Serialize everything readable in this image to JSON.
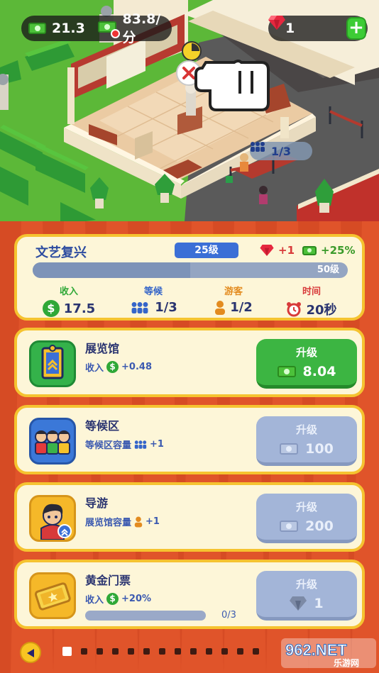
{
  "hud": {
    "money": "21.3",
    "income_rate": "83.8/分",
    "gems": "1"
  },
  "scene": {
    "visitor_count": "1/3"
  },
  "exhibit": {
    "name": "文艺复兴",
    "level": "25级",
    "reward_gem": "+1",
    "reward_pct": "+25%",
    "progress_label": "50级",
    "progress_fraction": 0.5,
    "stats": [
      {
        "label": "收入",
        "value": "17.5",
        "color": "#2fa837"
      },
      {
        "label": "等候",
        "value": "1/3",
        "color": "#3565c9"
      },
      {
        "label": "游客",
        "value": "1/2",
        "color": "#e38b1f"
      },
      {
        "label": "时间",
        "value": "20秒",
        "color": "#d83a3a"
      }
    ]
  },
  "upgrades": [
    {
      "title": "展览馆",
      "sub_prefix": "收入",
      "sub_value": "+0.48",
      "button_label": "升级",
      "cost": "8.04",
      "enabled": true,
      "icon": "gallery-icon"
    },
    {
      "title": "等候区",
      "sub_prefix": "等候区容量",
      "sub_value": "+1",
      "button_label": "升级",
      "cost": "100",
      "enabled": false,
      "icon": "waiting-people-icon"
    },
    {
      "title": "导游",
      "sub_prefix": "展览馆容量",
      "sub_value": "+1",
      "button_label": "升级",
      "cost": "200",
      "enabled": false,
      "icon": "guide-icon"
    },
    {
      "title": "黄金门票",
      "sub_prefix": "收入",
      "sub_value": "+20%",
      "button_label": "升级",
      "cost": "1",
      "enabled": false,
      "icon": "golden-ticket-icon",
      "progress": "0/3"
    }
  ],
  "watermark": {
    "brand": "962.NET",
    "sub": "乐游网"
  }
}
